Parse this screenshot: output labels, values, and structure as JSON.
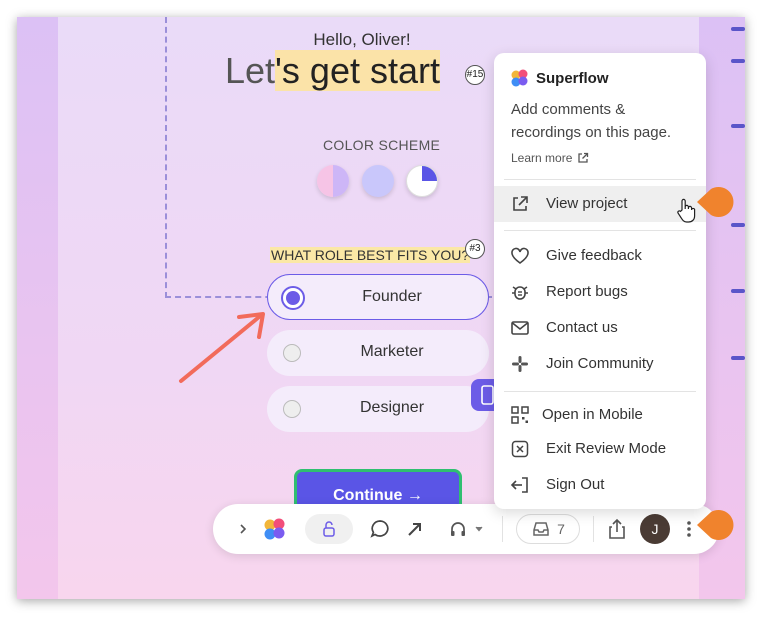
{
  "page": {
    "greeting": "Hello, Oliver!",
    "headline_prefix": "Let",
    "headline_highlight": "'s get start",
    "headline_suffix": "e",
    "headline_badge": "#15",
    "color_scheme_label": "COLOR SCHEME",
    "role_question": "WHAT ROLE BEST FITS YOU?",
    "role_badge": "#3",
    "roles": [
      {
        "label": "Founder",
        "selected": true
      },
      {
        "label": "Marketer",
        "selected": false
      },
      {
        "label": "Designer",
        "selected": false
      }
    ],
    "continue_label": "Continue →",
    "sticky_badge": "#"
  },
  "menu": {
    "brand": "Superflow",
    "description": "Add comments & recordings on this page.",
    "learn_more": "Learn more",
    "items": [
      {
        "label": "View project",
        "icon": "external-link-icon",
        "hovered": true
      },
      {
        "label": "Give feedback",
        "icon": "heart-icon"
      },
      {
        "label": "Report bugs",
        "icon": "bug-icon"
      },
      {
        "label": "Contact us",
        "icon": "mail-icon"
      },
      {
        "label": "Join Community",
        "icon": "slack-icon"
      },
      {
        "label": "Open in Mobile",
        "icon": "qr-code-icon"
      },
      {
        "label": "Exit Review Mode",
        "icon": "close-box-icon"
      },
      {
        "label": "Sign Out",
        "icon": "sign-out-icon"
      }
    ]
  },
  "toolbar": {
    "inbox_count": "7",
    "avatar_initial": "J"
  },
  "colors": {
    "accent": "#6c5ce7",
    "callout": "#f0832d",
    "arrow": "#f26b5b",
    "highlight": "#fbe3a8"
  }
}
